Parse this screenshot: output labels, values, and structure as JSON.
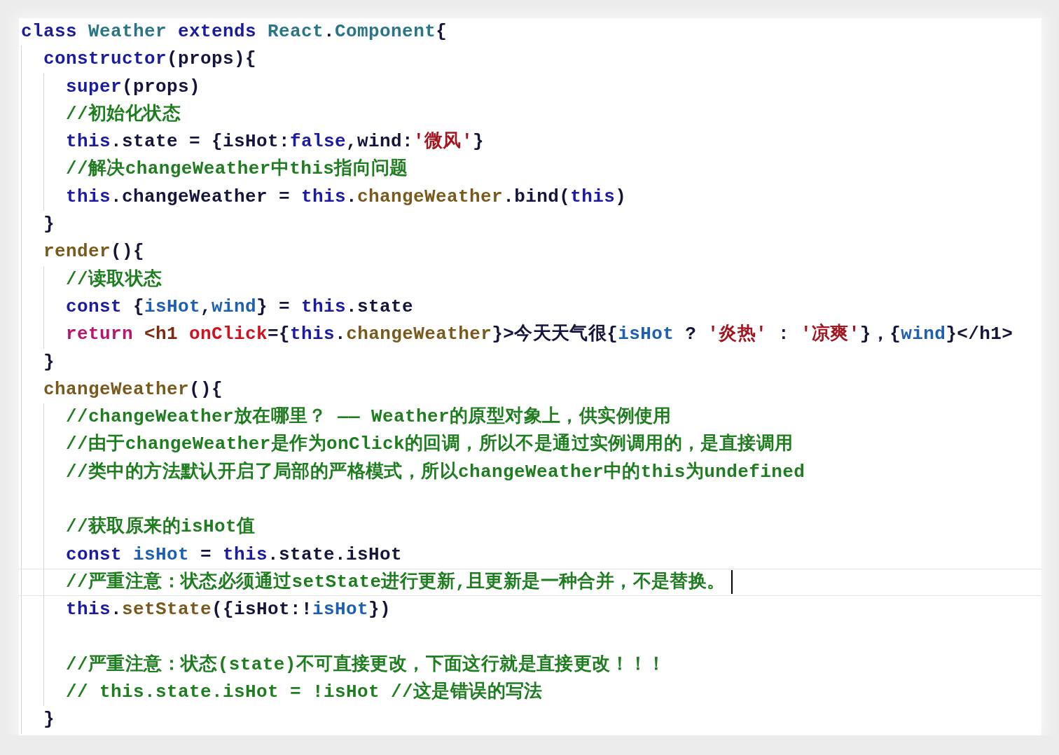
{
  "lines": [
    {
      "current": false,
      "tokens": [
        {
          "kind": "keyword",
          "text": "class "
        },
        {
          "kind": "type",
          "text": "Weather"
        },
        {
          "kind": "keyword",
          "text": " extends "
        },
        {
          "kind": "type",
          "text": "React"
        },
        {
          "kind": "plain",
          "text": "."
        },
        {
          "kind": "type",
          "text": "Component"
        },
        {
          "kind": "plain",
          "text": "{"
        }
      ],
      "children": [
        {
          "current": false,
          "tokens": [
            {
              "kind": "keyword",
              "text": "constructor"
            },
            {
              "kind": "plain",
              "text": "(props){"
            }
          ],
          "children": [
            {
              "current": false,
              "tokens": [
                {
                  "kind": "keyword",
                  "text": "super"
                },
                {
                  "kind": "plain",
                  "text": "(props)"
                }
              ]
            },
            {
              "current": false,
              "tokens": [
                {
                  "kind": "comment",
                  "text": "//初始化状态"
                }
              ]
            },
            {
              "current": false,
              "tokens": [
                {
                  "kind": "keyword",
                  "text": "this"
                },
                {
                  "kind": "plain",
                  "text": ".state = {isHot:"
                },
                {
                  "kind": "keyword",
                  "text": "false"
                },
                {
                  "kind": "plain",
                  "text": ",wind:"
                },
                {
                  "kind": "string",
                  "text": "'微风'"
                },
                {
                  "kind": "plain",
                  "text": "}"
                }
              ]
            },
            {
              "current": false,
              "tokens": [
                {
                  "kind": "comment",
                  "text": "//解决changeWeather中this指向问题"
                }
              ]
            },
            {
              "current": false,
              "tokens": [
                {
                  "kind": "keyword",
                  "text": "this"
                },
                {
                  "kind": "plain",
                  "text": ".changeWeather = "
                },
                {
                  "kind": "keyword",
                  "text": "this"
                },
                {
                  "kind": "plain",
                  "text": "."
                },
                {
                  "kind": "method",
                  "text": "changeWeather"
                },
                {
                  "kind": "plain",
                  "text": ".bind("
                },
                {
                  "kind": "keyword",
                  "text": "this"
                },
                {
                  "kind": "plain",
                  "text": ")"
                }
              ]
            }
          ]
        },
        {
          "current": false,
          "tokens": [
            {
              "kind": "plain",
              "text": "}"
            }
          ]
        },
        {
          "current": false,
          "tokens": [
            {
              "kind": "method",
              "text": "render"
            },
            {
              "kind": "plain",
              "text": "(){"
            }
          ],
          "children": [
            {
              "current": false,
              "tokens": [
                {
                  "kind": "comment",
                  "text": "//读取状态"
                }
              ]
            },
            {
              "current": false,
              "tokens": [
                {
                  "kind": "keyword",
                  "text": "const "
                },
                {
                  "kind": "plain",
                  "text": "{"
                },
                {
                  "kind": "variable",
                  "text": "isHot"
                },
                {
                  "kind": "plain",
                  "text": ","
                },
                {
                  "kind": "variable",
                  "text": "wind"
                },
                {
                  "kind": "plain",
                  "text": "} = "
                },
                {
                  "kind": "keyword",
                  "text": "this"
                },
                {
                  "kind": "plain",
                  "text": ".state"
                }
              ]
            },
            {
              "current": false,
              "tokens": [
                {
                  "kind": "control",
                  "text": "return "
                },
                {
                  "kind": "tag",
                  "text": "<h1 "
                },
                {
                  "kind": "attribute",
                  "text": "onClick"
                },
                {
                  "kind": "plain",
                  "text": "={"
                },
                {
                  "kind": "keyword",
                  "text": "this"
                },
                {
                  "kind": "plain",
                  "text": "."
                },
                {
                  "kind": "method",
                  "text": "changeWeather"
                },
                {
                  "kind": "plain",
                  "text": "}>今天天气很{"
                },
                {
                  "kind": "variable",
                  "text": "isHot"
                },
                {
                  "kind": "plain",
                  "text": " ? "
                },
                {
                  "kind": "string",
                  "text": "'炎热'"
                },
                {
                  "kind": "plain",
                  "text": " : "
                },
                {
                  "kind": "string",
                  "text": "'凉爽'"
                },
                {
                  "kind": "plain",
                  "text": "}，{"
                },
                {
                  "kind": "variable",
                  "text": "wind"
                },
                {
                  "kind": "plain",
                  "text": "}</h1>"
                }
              ]
            }
          ]
        },
        {
          "current": false,
          "tokens": [
            {
              "kind": "plain",
              "text": "}"
            }
          ]
        },
        {
          "current": false,
          "tokens": [
            {
              "kind": "method",
              "text": "changeWeather"
            },
            {
              "kind": "plain",
              "text": "(){"
            }
          ],
          "children": [
            {
              "current": false,
              "tokens": [
                {
                  "kind": "comment",
                  "text": "//changeWeather放在哪里？ —— Weather的原型对象上，供实例使用"
                }
              ]
            },
            {
              "current": false,
              "tokens": [
                {
                  "kind": "comment",
                  "text": "//由于changeWeather是作为onClick的回调，所以不是通过实例调用的，是直接调用"
                }
              ]
            },
            {
              "current": false,
              "tokens": [
                {
                  "kind": "comment",
                  "text": "//类中的方法默认开启了局部的严格模式，所以changeWeather中的this为undefined"
                }
              ]
            },
            {
              "current": false
            },
            {
              "current": false,
              "tokens": [
                {
                  "kind": "comment",
                  "text": "//获取原来的isHot值"
                }
              ]
            },
            {
              "current": false,
              "tokens": [
                {
                  "kind": "keyword",
                  "text": "const "
                },
                {
                  "kind": "variable",
                  "text": "isHot"
                },
                {
                  "kind": "plain",
                  "text": " = "
                },
                {
                  "kind": "keyword",
                  "text": "this"
                },
                {
                  "kind": "plain",
                  "text": ".state.isHot"
                }
              ]
            },
            {
              "current": true,
              "tokens": [
                {
                  "kind": "comment",
                  "text": "//严重注意：状态必须通过setState进行更新,且更新是一种合并，不是替换。"
                }
              ]
            },
            {
              "current": false,
              "tokens": [
                {
                  "kind": "keyword",
                  "text": "this"
                },
                {
                  "kind": "plain",
                  "text": "."
                },
                {
                  "kind": "method",
                  "text": "setState"
                },
                {
                  "kind": "plain",
                  "text": "({isHot:!"
                },
                {
                  "kind": "variable",
                  "text": "isHot"
                },
                {
                  "kind": "plain",
                  "text": "})"
                }
              ]
            },
            {
              "current": false
            },
            {
              "current": false,
              "tokens": [
                {
                  "kind": "comment",
                  "text": "//严重注意：状态(state)不可直接更改，下面这行就是直接更改！！！"
                }
              ]
            },
            {
              "current": false,
              "tokens": [
                {
                  "kind": "comment",
                  "text": "// this.state.isHot = !isHot //这是错误的写法"
                }
              ]
            }
          ]
        },
        {
          "current": false,
          "tokens": [
            {
              "kind": "plain",
              "text": "}"
            }
          ]
        }
      ]
    }
  ]
}
